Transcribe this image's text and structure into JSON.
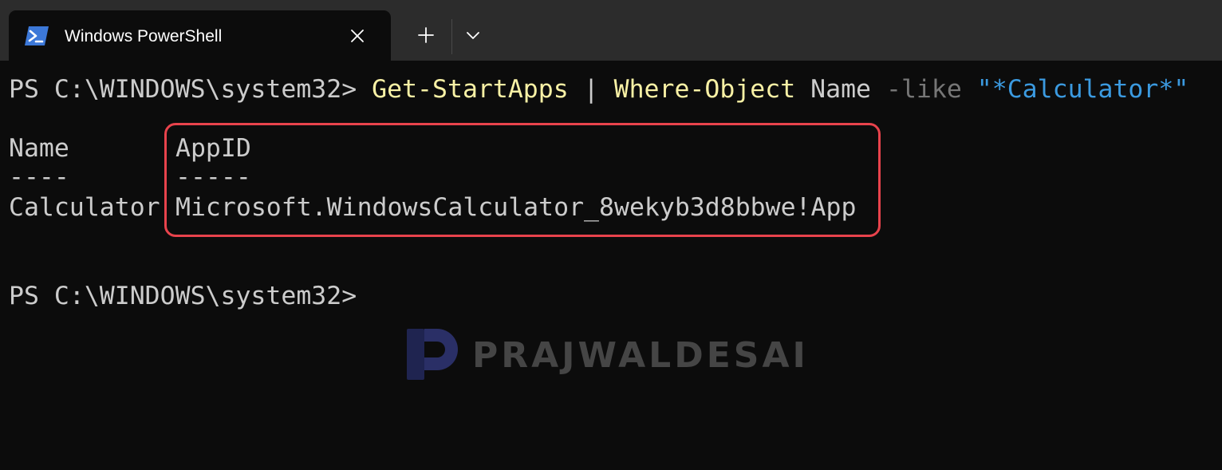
{
  "window": {
    "tab_title": "Windows PowerShell",
    "tab_icon": "powershell-icon",
    "close_icon": "close-icon",
    "new_tab_icon": "plus-icon",
    "dropdown_icon": "chevron-down-icon"
  },
  "terminal": {
    "command_line": {
      "prompt": "PS C:\\WINDOWS\\system32> ",
      "cmd1": "Get-StartApps",
      "pipe": " | ",
      "cmd2": "Where-Object",
      "arg": " Name ",
      "param": "-like",
      "space": " ",
      "string": "\"*Calculator*\""
    },
    "table": {
      "headers": [
        "Name",
        "AppID"
      ],
      "underlines": [
        "----",
        "-----"
      ],
      "rows": [
        {
          "name": "Calculator",
          "appid": "Microsoft.WindowsCalculator_8wekyb3d8bbwe!App"
        }
      ]
    },
    "prompt_line": "PS C:\\WINDOWS\\system32>"
  },
  "colors": {
    "background": "#0c0c0c",
    "tabbar": "#2c2c2c",
    "text": "#cccccc",
    "command": "#f9f1a5",
    "parameter": "#767676",
    "string": "#3b9ae0",
    "highlight": "#e8434c"
  },
  "watermark": {
    "logo": "prajwaldesai-logo-icon",
    "text": "PRAJWALDESAI"
  }
}
